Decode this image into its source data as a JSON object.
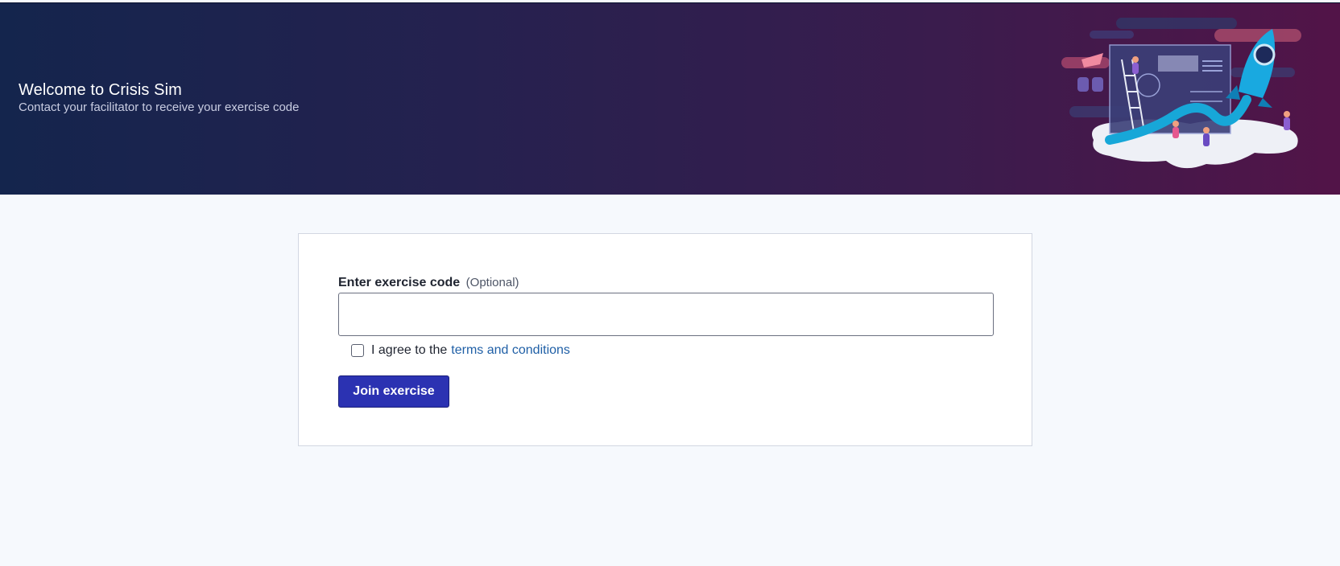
{
  "header": {
    "title": "Welcome to Crisis Sim",
    "subtitle": "Contact your facilitator to receive your exercise code"
  },
  "form": {
    "code_label": "Enter exercise code",
    "code_optional": "(Optional)",
    "code_value": "",
    "agree_prefix": "I agree to the",
    "terms_link": "terms and conditions",
    "join_button": "Join exercise"
  },
  "colors": {
    "header_start": "#14254d",
    "header_end": "#521448",
    "primary_button": "#2b32b2",
    "link": "#1f5fa6"
  }
}
